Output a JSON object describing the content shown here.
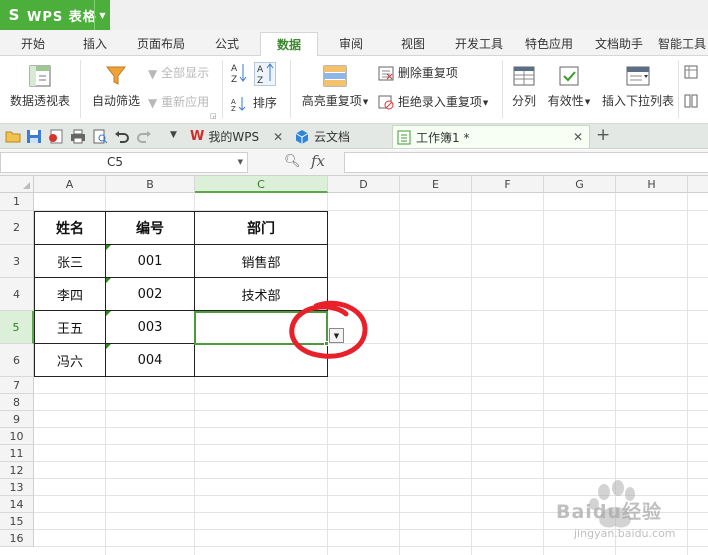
{
  "app": {
    "name": "WPS 表格",
    "logo": "S"
  },
  "menu": {
    "tabs": [
      {
        "label": "开始"
      },
      {
        "label": "插入"
      },
      {
        "label": "页面布局"
      },
      {
        "label": "公式"
      },
      {
        "label": "数据",
        "active": true
      },
      {
        "label": "审阅"
      },
      {
        "label": "视图"
      },
      {
        "label": "开发工具"
      },
      {
        "label": "特色应用"
      },
      {
        "label": "文档助手"
      },
      {
        "label": "智能工具"
      }
    ]
  },
  "ribbon": {
    "pivot_table": "数据透视表",
    "auto_filter": "自动筛选",
    "show_all": "全部显示",
    "reapply": "重新应用",
    "sort": "排序",
    "highlight_duplicates": "高亮重复项",
    "remove_duplicates": "删除重复项",
    "reject_duplicates": "拒绝录入重复项",
    "text_to_columns": "分列",
    "validation": "有效性",
    "insert_dropdown": "插入下拉列表",
    "sort_az": "A Z",
    "sort_za": "Z A"
  },
  "doc_tabs": [
    {
      "label": "我的WPS"
    },
    {
      "label": "云文档"
    },
    {
      "label": "工作簿1 *",
      "active": true
    }
  ],
  "formula_bar": {
    "name_box": "C5",
    "fx": "fx",
    "formula": ""
  },
  "sheet": {
    "columns": [
      "A",
      "B",
      "C",
      "D",
      "E",
      "F",
      "G",
      "H"
    ],
    "rows": [
      "1",
      "2",
      "3",
      "4",
      "5",
      "6",
      "7",
      "8",
      "9",
      "10",
      "11",
      "12",
      "13",
      "14",
      "15",
      "16"
    ],
    "selected_cell": "C5",
    "table": {
      "headers": [
        "姓名",
        "编号",
        "部门"
      ],
      "rows": [
        [
          "张三",
          "001",
          "销售部"
        ],
        [
          "李四",
          "002",
          "技术部"
        ],
        [
          "王五",
          "003",
          ""
        ],
        [
          "冯六",
          "004",
          ""
        ]
      ]
    }
  },
  "watermark": {
    "text": "Baidu经验",
    "sub": "jingyan.baidu.com"
  },
  "colors": {
    "accent": "#4caf3c",
    "selection": "#4c9a3b",
    "annotation": "#e8202a"
  }
}
